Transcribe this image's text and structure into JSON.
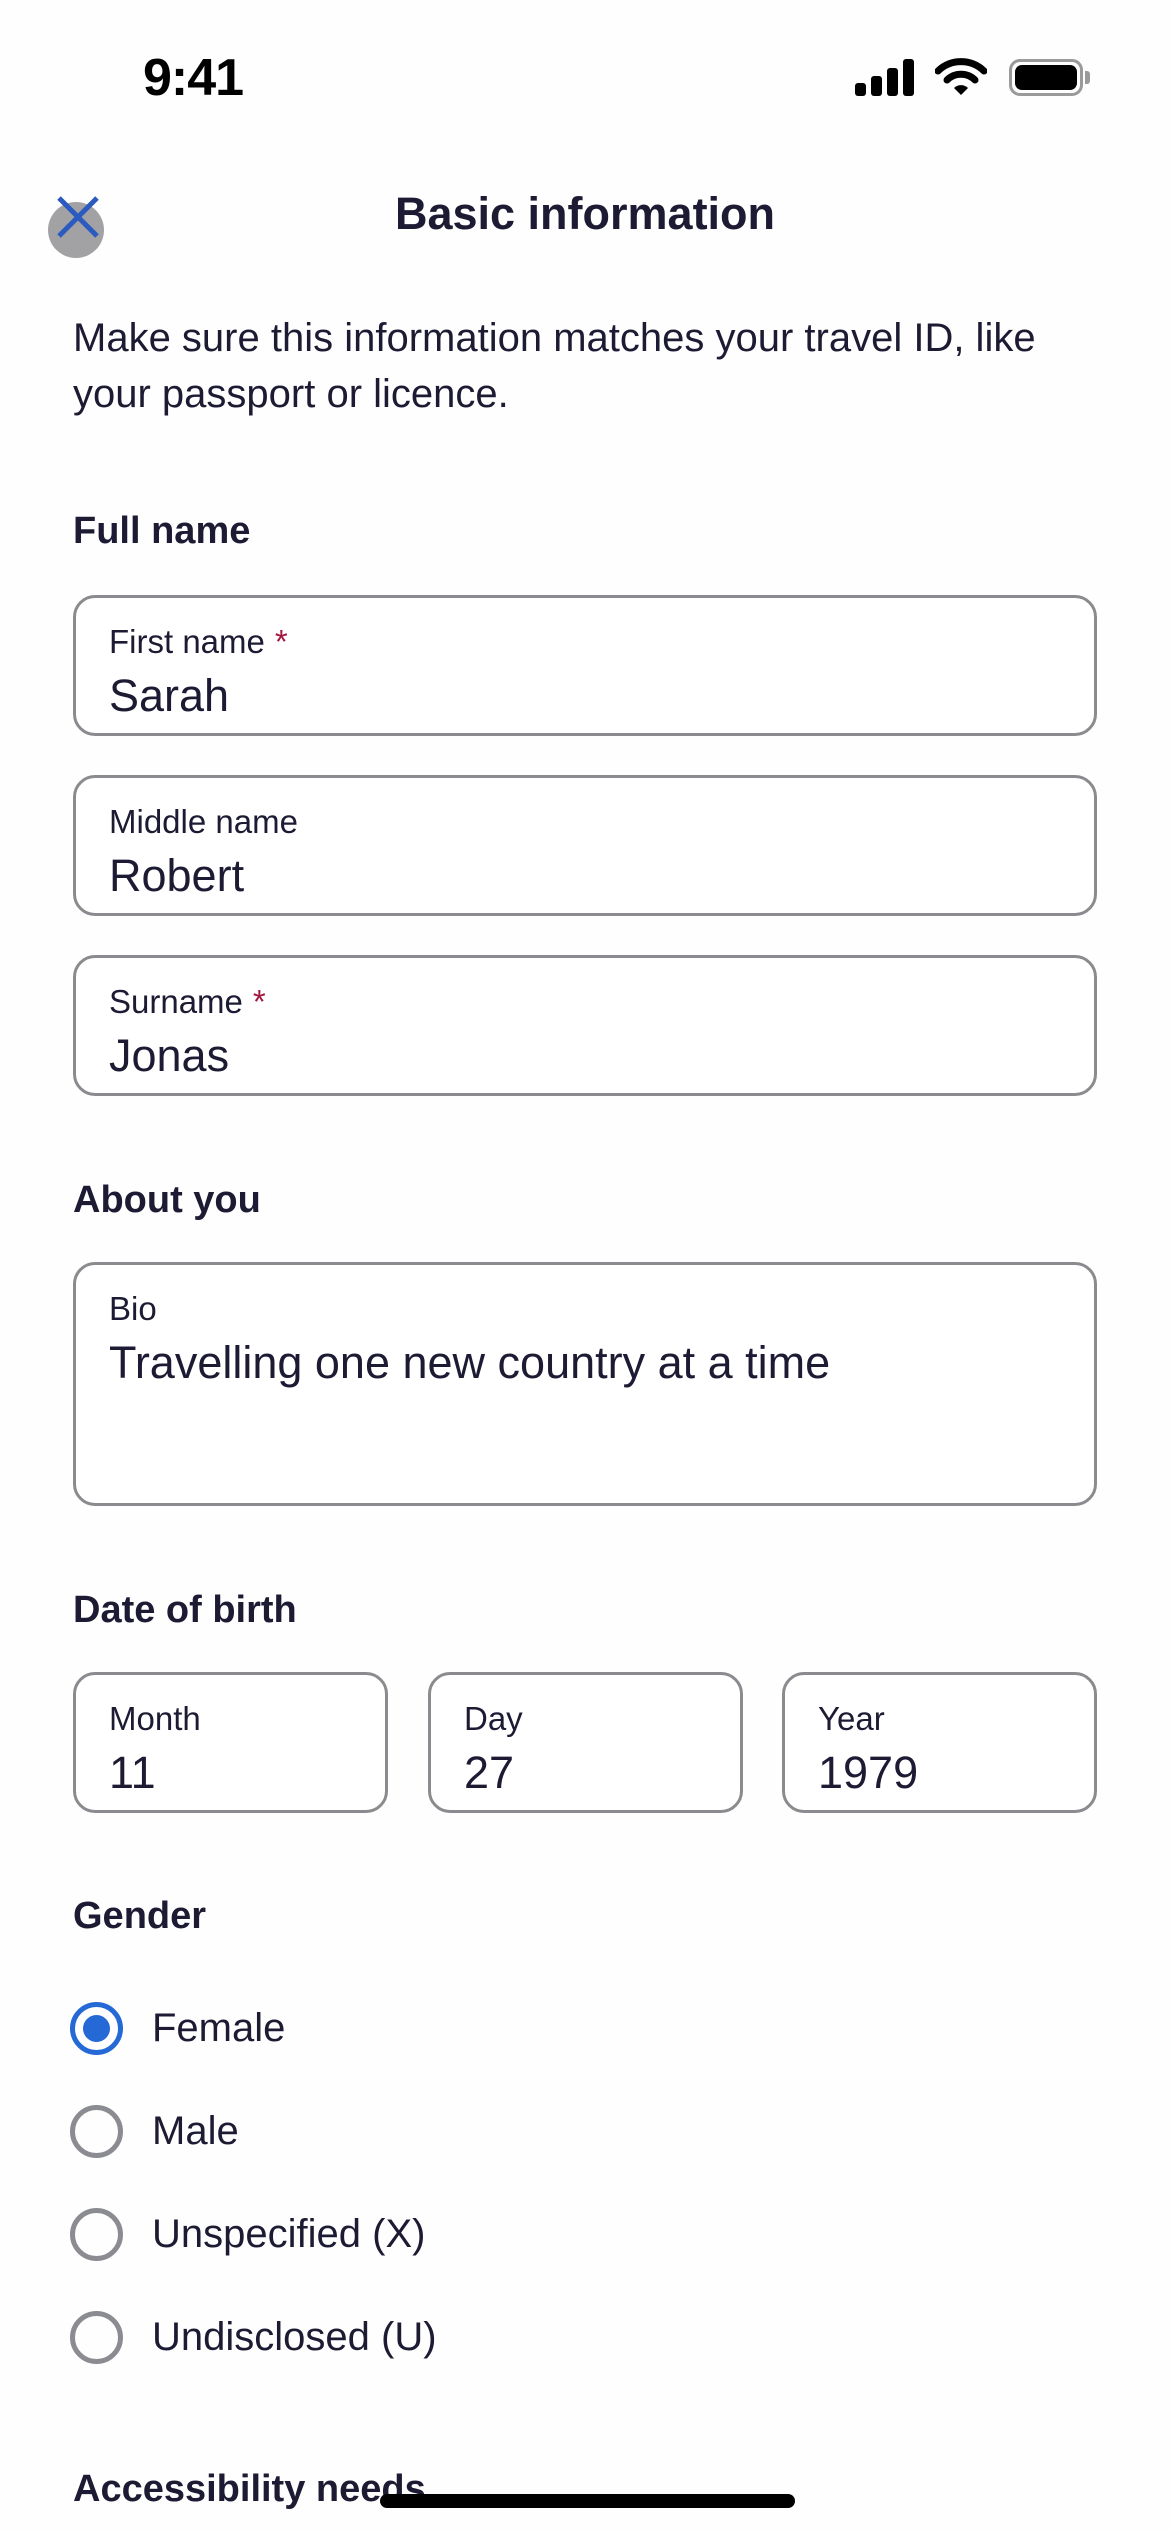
{
  "status_bar": {
    "time": "9:41",
    "icons": [
      "cellular-signal-icon",
      "wifi-icon",
      "battery-icon"
    ]
  },
  "header": {
    "title": "Basic information",
    "close_icon": "close-icon"
  },
  "description": "Make sure this information matches your travel ID, like your passport or licence.",
  "full_name": {
    "heading": "Full name",
    "fields": [
      {
        "label": "First name",
        "required": true,
        "value": "Sarah"
      },
      {
        "label": "Middle name",
        "required": false,
        "value": "Robert"
      },
      {
        "label": "Surname",
        "required": true,
        "value": "Jonas"
      }
    ],
    "required_marker": "*"
  },
  "about_you": {
    "heading": "About you",
    "bio": {
      "label": "Bio",
      "value": "Travelling one new country at a time"
    }
  },
  "date_of_birth": {
    "heading": "Date of birth",
    "month": {
      "label": "Month",
      "value": "11"
    },
    "day": {
      "label": "Day",
      "value": "27"
    },
    "year": {
      "label": "Year",
      "value": "1979"
    }
  },
  "gender": {
    "heading": "Gender",
    "selected": "Female",
    "options": [
      {
        "label": "Female",
        "checked": true
      },
      {
        "label": "Male",
        "checked": false
      },
      {
        "label": "Unspecified (X)",
        "checked": false
      },
      {
        "label": "Undisclosed (U)",
        "checked": false
      }
    ]
  },
  "accessibility": {
    "heading": "Accessibility needs"
  },
  "colors": {
    "text": "#1c1b33",
    "accent": "#2469d6",
    "required": "#a3163f",
    "border": "#8b8b8f"
  }
}
